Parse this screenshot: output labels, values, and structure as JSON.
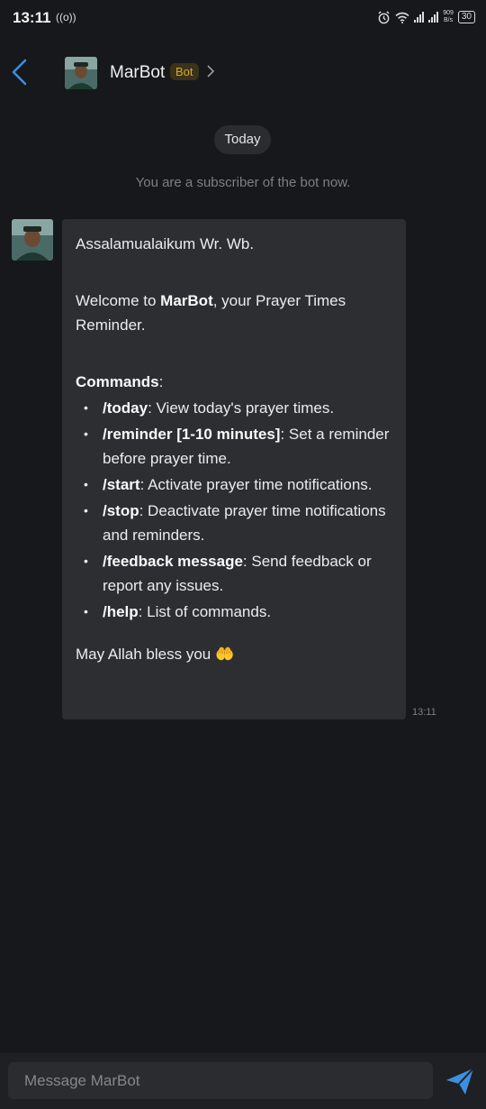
{
  "status_bar": {
    "time": "13:11",
    "hotspot_icon": "((o))",
    "net_speed_top": "909",
    "net_speed_bottom": "B/s",
    "battery": "30"
  },
  "header": {
    "name": "MarBot",
    "badge": "Bot"
  },
  "chat": {
    "date_chip": "Today",
    "system_message": "You are a subscriber of the bot now.",
    "message": {
      "greeting": "Assalamualaikum Wr. Wb.",
      "welcome_pre": "Welcome to ",
      "welcome_bold": "MarBot",
      "welcome_post": ", your Prayer Times Reminder.",
      "commands_label": "Commands",
      "commands_colon": ":",
      "commands": [
        {
          "cmd": "/today",
          "desc": ": View today's prayer times."
        },
        {
          "cmd": "/reminder [1-10 minutes]",
          "desc": ": Set a reminder before prayer time."
        },
        {
          "cmd": "/start",
          "desc": ": Activate prayer time notifications."
        },
        {
          "cmd": "/stop",
          "desc": ": Deactivate prayer time notifications and reminders."
        },
        {
          "cmd": "/feedback message",
          "desc": ": Send feedback or report any issues."
        },
        {
          "cmd": "/help",
          "desc": ": List of commands."
        }
      ],
      "closing": "May Allah bless you 🤲",
      "time": "13:11"
    }
  },
  "composer": {
    "placeholder": "Message MarBot"
  },
  "colors": {
    "background": "#17181b",
    "bubble": "#2d2e32",
    "accent_blue": "#3d8fe0",
    "badge_text": "#d9a92e"
  },
  "icons": {
    "back": "back-arrow-icon",
    "chevron": "chevron-right-icon",
    "send": "send-icon",
    "alarm": "alarm-icon",
    "wifi": "wifi-icon",
    "signal": "signal-icon"
  }
}
